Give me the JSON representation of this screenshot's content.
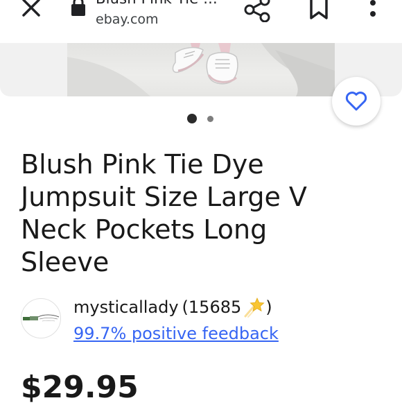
{
  "browser": {
    "page_title": "Blush Pink Tie ...",
    "domain": "ebay.com",
    "icons": {
      "close": "close-icon",
      "lock": "lock-icon",
      "share": "share-icon",
      "bookmark": "bookmark-icon",
      "menu": "more-vert-icon"
    }
  },
  "gallery": {
    "photo_alt": "product-photo",
    "dots": {
      "count": 2,
      "active_index": 0
    },
    "watch_icon": "heart-icon"
  },
  "listing": {
    "title": "Blush Pink Tie Dye\nJumpsuit Size Large  V\nNeck Pockets Long\nSleeve",
    "seller": {
      "name": "mysticallady",
      "rating_open": "(15685",
      "rating_close": ")",
      "star_icon": "shooting-star-icon",
      "feedback": "99.7% positive feedback"
    },
    "price": "$29.95"
  },
  "colors": {
    "link": "#3665f3",
    "text": "#191919",
    "heart": "#3665f3"
  }
}
